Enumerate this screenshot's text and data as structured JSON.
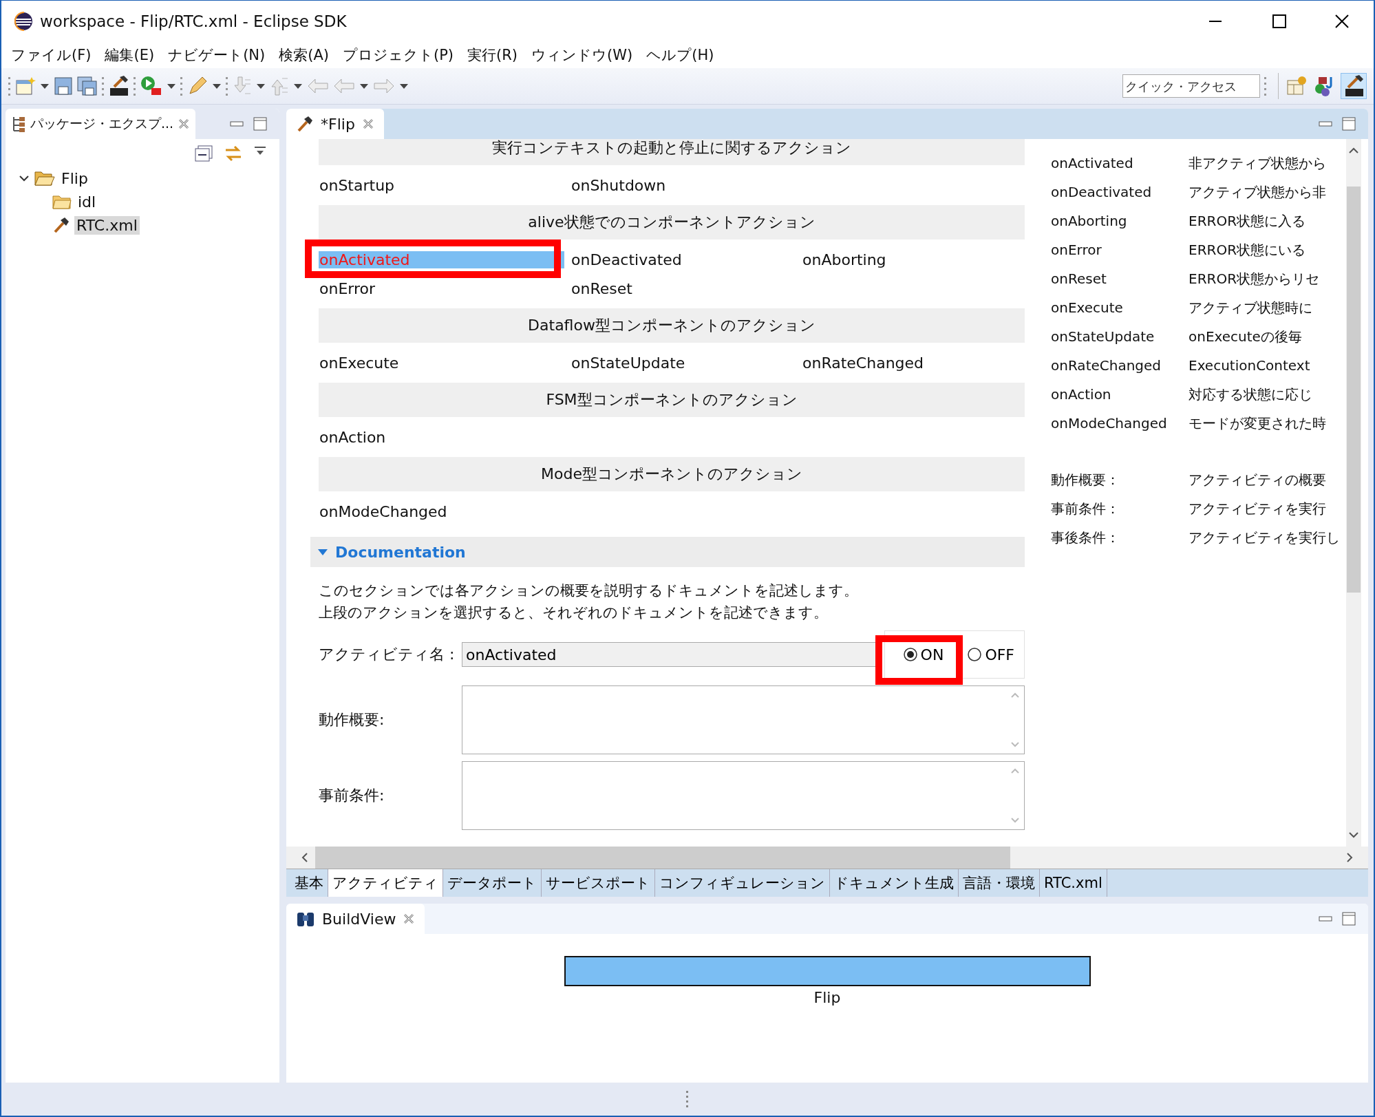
{
  "window": {
    "title": "workspace - Flip/RTC.xml - Eclipse SDK"
  },
  "menu": [
    "ファイル(F)",
    "編集(E)",
    "ナビゲート(N)",
    "検索(A)",
    "プロジェクト(P)",
    "実行(R)",
    "ウィンドウ(W)",
    "ヘルプ(H)"
  ],
  "quick_access": {
    "placeholder": "クイック・アクセス"
  },
  "package_explorer": {
    "title": "パッケージ・エクスプ...",
    "tree": [
      {
        "label": "Flip",
        "kind": "project",
        "expanded": true,
        "selected": false,
        "children": [
          {
            "label": "idl",
            "kind": "folder",
            "selected": false
          },
          {
            "label": "RTC.xml",
            "kind": "file",
            "selected": true
          }
        ]
      }
    ]
  },
  "editor": {
    "tab": "*Flip",
    "action_groups": [
      {
        "title": "実行コンテキストの起動と停止に関するアクション",
        "actions": [
          {
            "label": "onStartup",
            "selected": false,
            "highlighted": false
          },
          {
            "label": "onShutdown",
            "selected": false,
            "highlighted": false
          }
        ]
      },
      {
        "title": "alive状態でのコンポーネントアクション",
        "actions": [
          {
            "label": "onActivated",
            "selected": true,
            "highlighted": true
          },
          {
            "label": "onDeactivated",
            "selected": false,
            "highlighted": false
          },
          {
            "label": "onAborting",
            "selected": false,
            "highlighted": false
          },
          {
            "label": "onError",
            "selected": false,
            "highlighted": false
          },
          {
            "label": "onReset",
            "selected": false,
            "highlighted": false
          }
        ]
      },
      {
        "title": "Dataflow型コンポーネントのアクション",
        "actions": [
          {
            "label": "onExecute",
            "selected": false,
            "highlighted": false
          },
          {
            "label": "onStateUpdate",
            "selected": false,
            "highlighted": false
          },
          {
            "label": "onRateChanged",
            "selected": false,
            "highlighted": false
          }
        ]
      },
      {
        "title": "FSM型コンポーネントのアクション",
        "actions": [
          {
            "label": "onAction",
            "selected": false,
            "highlighted": false
          }
        ]
      },
      {
        "title": "Mode型コンポーネントのアクション",
        "actions": [
          {
            "label": "onModeChanged",
            "selected": false,
            "highlighted": false
          }
        ]
      }
    ],
    "documentation": {
      "title": "Documentation",
      "expanded": true,
      "intro": [
        "このセクションでは各アクションの概要を説明するドキュメントを記述します。",
        "上段のアクションを選択すると、それぞれのドキュメントを記述できます。"
      ],
      "fields": [
        {
          "label": "アクティビティ名 :",
          "kind": "text",
          "value": "onActivated"
        },
        {
          "label": "動作概要:",
          "kind": "textarea"
        },
        {
          "label": "事前条件:",
          "kind": "textarea"
        }
      ],
      "switch": {
        "highlighted": true,
        "options": [
          {
            "label": "ON",
            "selected": true
          },
          {
            "label": "OFF",
            "selected": false
          }
        ]
      }
    },
    "summary": {
      "actions": [
        {
          "name": "onActivated",
          "description": "非アクティブ状態から"
        },
        {
          "name": "onDeactivated",
          "description": "アクティブ状態から非"
        },
        {
          "name": "onAborting",
          "description": "ERROR状態に入る"
        },
        {
          "name": "onError",
          "description": "ERROR状態にいる"
        },
        {
          "name": "onReset",
          "description": "ERROR状態からリセ"
        },
        {
          "name": "onExecute",
          "description": "アクティブ状態時に"
        },
        {
          "name": "onStateUpdate",
          "description": "onExecuteの後毎"
        },
        {
          "name": "onRateChanged",
          "description": "ExecutionContext"
        },
        {
          "name": "onAction",
          "description": "対応する状態に応じ"
        },
        {
          "name": "onModeChanged",
          "description": "モードが変更された時"
        }
      ],
      "docs": [
        {
          "label": "動作概要：",
          "value": "アクティビティの概要"
        },
        {
          "label": "事前条件：",
          "value": "アクティビティを実行"
        },
        {
          "label": "事後条件：",
          "value": "アクティビティを実行し"
        }
      ]
    },
    "page_tabs": [
      {
        "label": "基本",
        "selected": false
      },
      {
        "label": "アクティビティ",
        "selected": true
      },
      {
        "label": "データポート",
        "selected": false
      },
      {
        "label": "サービスポート",
        "selected": false
      },
      {
        "label": "コンフィギュレーション",
        "selected": false
      },
      {
        "label": "ドキュメント生成",
        "selected": false
      },
      {
        "label": "言語・環境",
        "selected": false
      },
      {
        "label": "RTC.xml",
        "selected": false
      }
    ]
  },
  "build_view": {
    "tab": "BuildView",
    "components": [
      {
        "name": "Flip"
      }
    ]
  }
}
